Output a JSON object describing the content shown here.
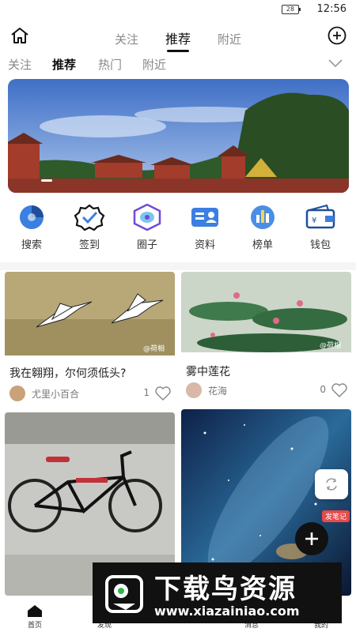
{
  "status_bar": {
    "battery": "28",
    "time": "12:56"
  },
  "top_nav": {
    "tabs": [
      {
        "label": "关注"
      },
      {
        "label": "推荐"
      },
      {
        "label": "附近"
      }
    ],
    "active_tab": "推荐"
  },
  "sub_nav": {
    "tabs": [
      {
        "label": "关注"
      },
      {
        "label": "推荐"
      },
      {
        "label": "热门"
      },
      {
        "label": "附近"
      }
    ],
    "active_tab": "推荐"
  },
  "banner": {
    "image": "temple-landscape",
    "slides": 1,
    "active_slide": 1
  },
  "shortcuts": [
    {
      "label": "搜索",
      "icon": "search-icon"
    },
    {
      "label": "签到",
      "icon": "checkin-icon"
    },
    {
      "label": "圈子",
      "icon": "circle-icon"
    },
    {
      "label": "资料",
      "icon": "profile-card-icon"
    },
    {
      "label": "榜单",
      "icon": "ranking-icon"
    },
    {
      "label": "钱包",
      "icon": "wallet-icon"
    }
  ],
  "posts": [
    {
      "title": "我在翱翔，尔何须低头?",
      "author": "尤里小百合",
      "likes": "1",
      "image": "flying-cranes"
    },
    {
      "title": "雾中莲花",
      "author": "花海",
      "likes": "0",
      "image": "lotus-in-fog"
    },
    {
      "title": "",
      "author": "",
      "likes": "",
      "image": "bicycle"
    },
    {
      "title": "",
      "author": "",
      "likes": "",
      "image": "starry-sky"
    }
  ],
  "fab": {
    "note_badge": "发笔记"
  },
  "bottom_nav": {
    "items": [
      {
        "label": "首页",
        "icon": "home-icon"
      },
      {
        "label": "发现",
        "icon": "discover-icon"
      },
      {
        "label": "消息",
        "icon": "message-icon"
      },
      {
        "label": "我的",
        "icon": "user-icon"
      }
    ]
  },
  "watermark": {
    "title": "下载鸟资源",
    "url": "www.xiazainiao.com"
  },
  "colors": {
    "accent": "#111111",
    "badge": "#e64a4a",
    "icon_blue": "#3b7fe0",
    "icon_purple": "#6f4bd8"
  }
}
